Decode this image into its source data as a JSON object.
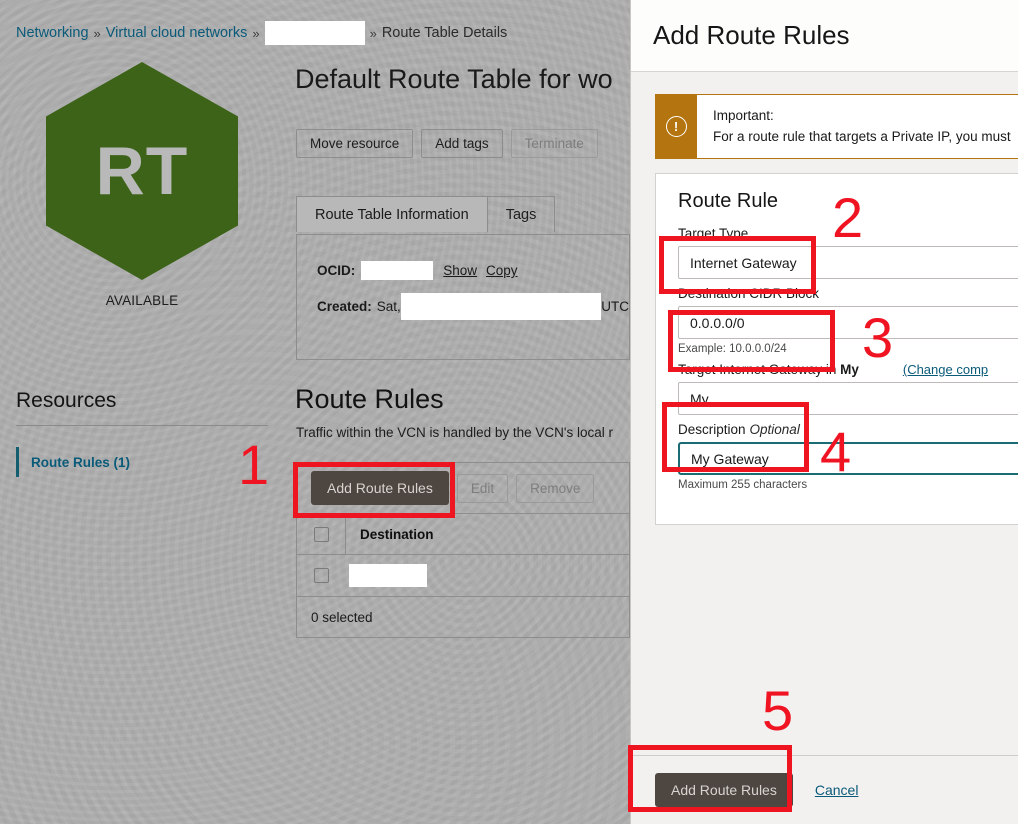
{
  "breadcrumb": {
    "items": [
      {
        "label": "Networking",
        "type": "link"
      },
      {
        "label": "Virtual cloud networks",
        "type": "link"
      },
      {
        "label": "",
        "type": "redacted"
      },
      {
        "label": "Route Table Details",
        "type": "current"
      }
    ],
    "separator": "»"
  },
  "resource_badge": {
    "initials": "RT",
    "status": "AVAILABLE",
    "color": "#3c6318"
  },
  "resources": {
    "heading": "Resources",
    "items": [
      {
        "label": "Route Rules (1)",
        "active": true
      }
    ]
  },
  "main": {
    "title": "Default Route Table for wo",
    "actions": [
      {
        "label": "Move resource",
        "disabled": false
      },
      {
        "label": "Add tags",
        "disabled": false
      },
      {
        "label": "Terminate",
        "disabled": true
      }
    ],
    "tabs": [
      {
        "label": "Route Table Information",
        "active": true
      },
      {
        "label": "Tags",
        "active": false
      }
    ],
    "info": {
      "ocid_label": "OCID:",
      "ocid_value": "",
      "ocid_show": "Show",
      "ocid_copy": "Copy",
      "created_label": "Created:",
      "created_prefix": "Sat,",
      "created_value": "",
      "created_suffix": "UTC"
    },
    "route_rules": {
      "title": "Route Rules",
      "subtitle": "Traffic within the VCN is handled by the VCN's local r",
      "toolbar": [
        {
          "label": "Add Route Rules",
          "style": "primary"
        },
        {
          "label": "Edit",
          "style": "ghost"
        },
        {
          "label": "Remove",
          "style": "ghost"
        }
      ],
      "columns": [
        "Destination"
      ],
      "rows": [
        {
          "destination": ""
        }
      ],
      "footer": "0 selected"
    }
  },
  "panel": {
    "title": "Add Route Rules",
    "warning": {
      "icon": "exclamation-circle-icon",
      "title": "Important:",
      "text": "For a route rule that targets a Private IP, you must",
      "accent": "#b4740f"
    },
    "card_title": "Route Rule",
    "fields": [
      {
        "label": "Target Type",
        "value": "Internet Gateway",
        "hint": "",
        "focused": false
      },
      {
        "label": "Destination CIDR Block",
        "value": "0.0.0.0/0",
        "hint": "Example: 10.0.0.0/24",
        "focused": false
      },
      {
        "label": "Target Internet Gateway in ",
        "label_bold": "My",
        "link": "(Change comp",
        "value": "My",
        "hint": "",
        "focused": false
      },
      {
        "label": "Description",
        "optional": "Optional",
        "value": "My Gateway",
        "hint": "Maximum 255 characters",
        "focused": true
      }
    ],
    "footer": {
      "submit": "Add Route Rules",
      "cancel": "Cancel"
    }
  },
  "annotations": {
    "color": "#ee1520",
    "numbers": [
      "1",
      "2",
      "3",
      "4",
      "5"
    ]
  }
}
